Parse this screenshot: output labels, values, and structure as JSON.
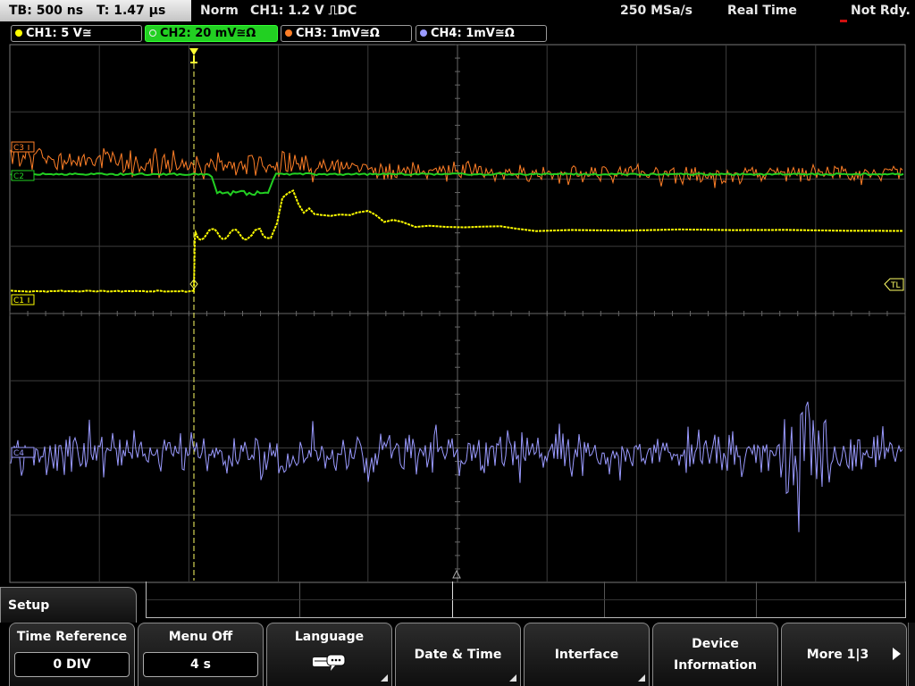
{
  "status": {
    "timebase": "TB: 500 ns",
    "trigger_time": "T: 1.47 µs",
    "mode": "Norm",
    "trigger_info": "CH1: 1.2 V ⎍DC",
    "sample_rate": "250 MSa/s",
    "acq_mode": "Real Time",
    "ready_state": "Not Rdy."
  },
  "channels": [
    {
      "label": "CH1: 5 V≅",
      "color": "#ffff00"
    },
    {
      "label": "CH2: 20 mV≅Ω",
      "color": "#22d022"
    },
    {
      "label": "CH3: 1mV≅Ω",
      "color": "#ff7f27"
    },
    {
      "label": "CH4: 1mV≅Ω",
      "color": "#9a9aff"
    }
  ],
  "scope": {
    "grid_divisions": {
      "horizontal": 10,
      "vertical": 8
    },
    "markers": {
      "c3": "C3",
      "c2": "C2",
      "c1": "C1",
      "c4": "C4",
      "trigger_level": "TL",
      "trigger_pos": "T"
    }
  },
  "menu": {
    "title": "Setup",
    "softkeys": [
      {
        "label": "Time Reference",
        "value": "0 DIV"
      },
      {
        "label": "Menu Off",
        "value": "4 s"
      },
      {
        "label": "Language",
        "icon": "speech-bubble-icon"
      },
      {
        "label": "Date & Time"
      },
      {
        "label": "Interface"
      },
      {
        "label1": "Device",
        "label2": "Information"
      },
      {
        "label": "More 1|3"
      }
    ]
  }
}
